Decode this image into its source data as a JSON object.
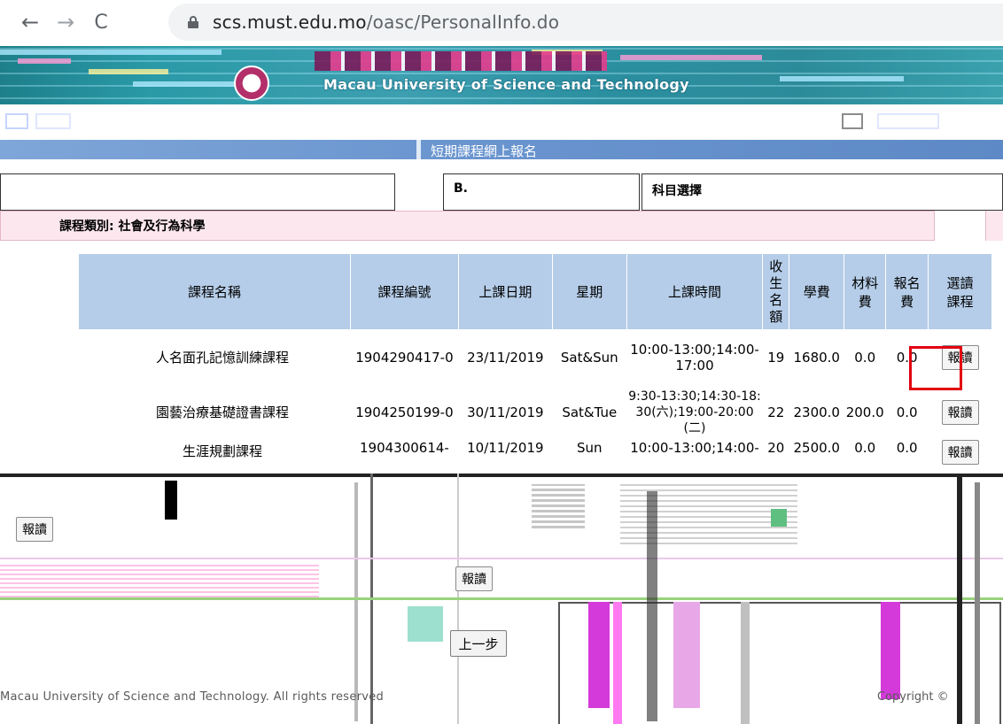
{
  "browser": {
    "back_glyph": "←",
    "forward_glyph": "→",
    "reload_glyph": "C",
    "url_host": "scs.must.edu.mo",
    "url_path": "/oasc/PersonalInfo.do"
  },
  "header": {
    "english_name": "Macau University of Science and Technology"
  },
  "page": {
    "title": "短期課程網上報名",
    "section_b": "B.",
    "subject_choice": "科目選擇"
  },
  "category": {
    "label": "課程類別: 社會及行為科學"
  },
  "table": {
    "headers": {
      "name": "課程名稱",
      "code": "課程編號",
      "date": "上課日期",
      "weekday": "星期",
      "time": "上課時間",
      "quota": "收\n生\n名\n額",
      "tuition": "學費",
      "material": "材料\n費",
      "registration": "報名\n費",
      "select": "選讀\n課程"
    },
    "rows": [
      {
        "name": "人名面孔記憶訓練課程",
        "code": "1904290417-0",
        "date": "23/11/2019",
        "weekday": "Sat&Sun",
        "time": "10:00-13:00;14:00-17:00",
        "quota": "19",
        "tuition": "1680.0",
        "material": "0.0",
        "registration": "0.0",
        "button": "報讀"
      },
      {
        "name": "園藝治療基礎證書課程",
        "code": "1904250199-0",
        "date": "30/11/2019",
        "weekday": "Sat&Tue",
        "time": "9:30-13:30;14:30-18:30(六);19:00-20:00(二)",
        "quota": "22",
        "tuition": "2300.0",
        "material": "200.0",
        "registration": "0.0",
        "button": "報讀"
      },
      {
        "name": "生涯規劃課程",
        "code": "1904300614-",
        "date": "10/11/2019",
        "weekday": "Sun",
        "time": "10:00-13:00;14:00-",
        "quota": "20",
        "tuition": "2500.0",
        "material": "0.0",
        "registration": "0.0",
        "button": "報讀"
      }
    ]
  },
  "glitch": {
    "left_button": "報讀",
    "middle_button": "報讀",
    "prev_button": "上一步",
    "footer_left": "Macau University of Science and Technology. All rights reserved",
    "footer_right": "Copyright ©"
  },
  "colors": {
    "header_teal": "#2a9aa7",
    "title_blue": "#6a95cf",
    "table_header": "#b5cde8",
    "category_pink": "#fde7ee",
    "highlight_red": "#e3000f"
  }
}
